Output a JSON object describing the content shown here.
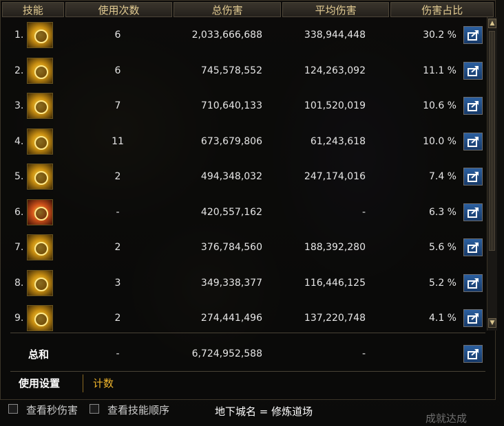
{
  "headers": {
    "skill": "技能",
    "uses": "使用次数",
    "total": "总伤害",
    "average": "平均伤害",
    "share": "伤害占比"
  },
  "rows": [
    {
      "index": "1.",
      "uses": "6",
      "total": "2,033,666,688",
      "average": "338,944,448",
      "pct": "30.2 %"
    },
    {
      "index": "2.",
      "uses": "6",
      "total": "745,578,552",
      "average": "124,263,092",
      "pct": "11.1 %"
    },
    {
      "index": "3.",
      "uses": "7",
      "total": "710,640,133",
      "average": "101,520,019",
      "pct": "10.6 %"
    },
    {
      "index": "4.",
      "uses": "11",
      "total": "673,679,806",
      "average": "61,243,618",
      "pct": "10.0 %"
    },
    {
      "index": "5.",
      "uses": "2",
      "total": "494,348,032",
      "average": "247,174,016",
      "pct": "7.4 %"
    },
    {
      "index": "6.",
      "uses": "-",
      "total": "420,557,162",
      "average": "-",
      "pct": "6.3 %"
    },
    {
      "index": "7.",
      "uses": "2",
      "total": "376,784,560",
      "average": "188,392,280",
      "pct": "5.6 %"
    },
    {
      "index": "8.",
      "uses": "3",
      "total": "349,338,377",
      "average": "116,446,125",
      "pct": "5.2 %"
    },
    {
      "index": "9.",
      "uses": "2",
      "total": "274,441,496",
      "average": "137,220,748",
      "pct": "4.1 %"
    }
  ],
  "summary": {
    "label": "总和",
    "uses": "-",
    "total": "6,724,952,588",
    "average": "-"
  },
  "tabs": {
    "settings": "使用设置",
    "count": "计数"
  },
  "bottom": {
    "check1": "查看秒伤害",
    "check2": "查看技能顺序",
    "city": "地下城名 = 修炼道场",
    "achievement": "成就达成"
  },
  "colors": {
    "header_text": "#e3cc93",
    "tab_active": "#ffffff",
    "tab_count": "#f0b52c",
    "share_button": "#2b5f9f"
  },
  "icons": [
    "share-icon",
    "skill-icon",
    "scroll-up-icon",
    "scroll-down-icon",
    "checkbox"
  ]
}
